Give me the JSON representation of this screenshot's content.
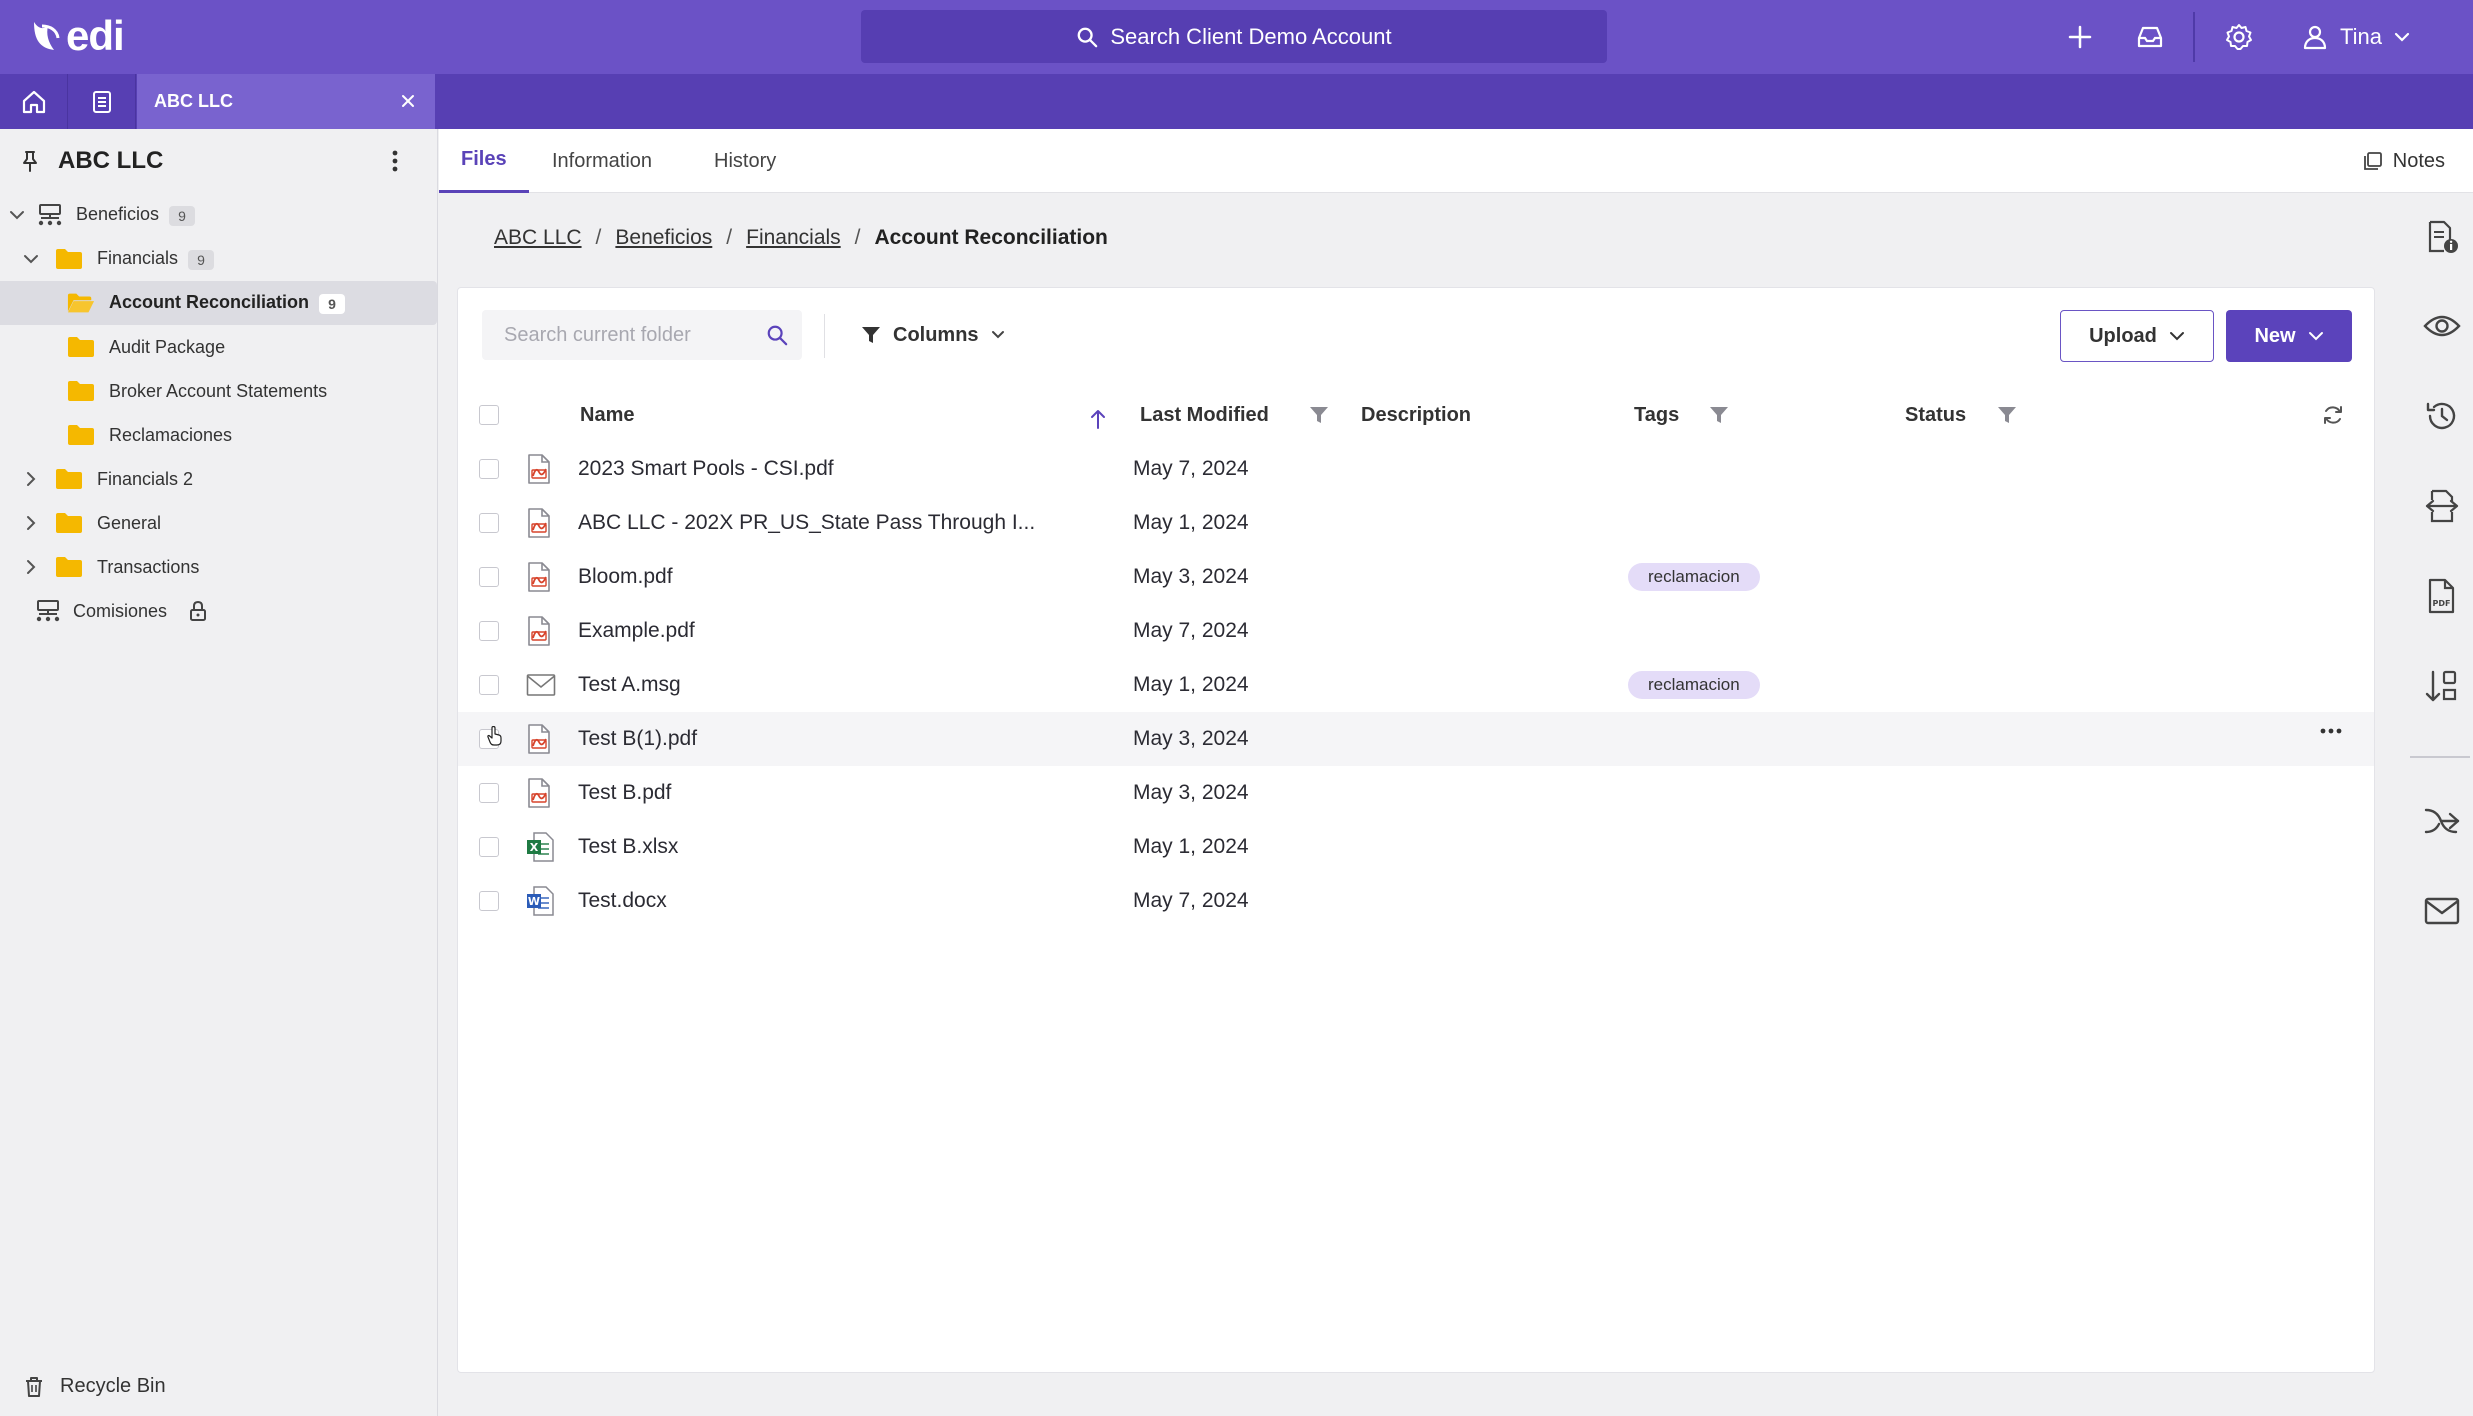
{
  "app": {
    "logo_text": "edi",
    "search_placeholder": "Search Client Demo Account",
    "user_name": "Tina"
  },
  "tabs": {
    "open_tab_label": "ABC LLC"
  },
  "sidebar": {
    "client_name": "ABC LLC",
    "tree": [
      {
        "label": "Beneficios",
        "count": "9"
      },
      {
        "label": "Financials",
        "count": "9"
      },
      {
        "label": "Account Reconciliation",
        "count": "9"
      },
      {
        "label": "Audit Package"
      },
      {
        "label": "Broker Account Statements"
      },
      {
        "label": "Reclamaciones"
      },
      {
        "label": "Financials 2"
      },
      {
        "label": "General"
      },
      {
        "label": "Transactions"
      },
      {
        "label": "Comisiones"
      }
    ],
    "recycle_bin": "Recycle Bin"
  },
  "content_tabs": {
    "files": "Files",
    "information": "Information",
    "history": "History",
    "notes": "Notes"
  },
  "breadcrumb": {
    "items": [
      "ABC LLC",
      "Beneficios",
      "Financials"
    ],
    "current": "Account Reconciliation",
    "separator": "/"
  },
  "toolbar": {
    "search_placeholder": "Search current folder",
    "columns_label": "Columns",
    "upload_label": "Upload",
    "new_label": "New"
  },
  "table": {
    "headers": {
      "name": "Name",
      "last_modified": "Last Modified",
      "description": "Description",
      "tags": "Tags",
      "status": "Status"
    },
    "rows": [
      {
        "type": "pdf",
        "name": "2023 Smart Pools - CSI.pdf",
        "modified": "May 7, 2024",
        "tag": ""
      },
      {
        "type": "pdf",
        "name": "ABC LLC - 202X PR_US_State Pass Through I...",
        "modified": "May 1, 2024",
        "tag": ""
      },
      {
        "type": "pdf",
        "name": "Bloom.pdf",
        "modified": "May 3, 2024",
        "tag": "reclamacion"
      },
      {
        "type": "pdf",
        "name": "Example.pdf",
        "modified": "May 7, 2024",
        "tag": ""
      },
      {
        "type": "msg",
        "name": "Test A.msg",
        "modified": "May 1, 2024",
        "tag": "reclamacion"
      },
      {
        "type": "pdf",
        "name": "Test B(1).pdf",
        "modified": "May 3, 2024",
        "tag": ""
      },
      {
        "type": "pdf",
        "name": "Test B.pdf",
        "modified": "May 3, 2024",
        "tag": ""
      },
      {
        "type": "xlsx",
        "name": "Test B.xlsx",
        "modified": "May 1, 2024",
        "tag": ""
      },
      {
        "type": "docx",
        "name": "Test.docx",
        "modified": "May 7, 2024",
        "tag": ""
      }
    ]
  },
  "colors": {
    "topbar": "#6b52c6",
    "tabbar": "#573fb3",
    "accent": "#5b43bb",
    "folder": "#f5b800",
    "tag_bg": "#e4dcf8"
  },
  "icons": {
    "rail": [
      "file-info-icon",
      "eye-icon",
      "history-icon",
      "file-transfer-icon",
      "pdf-file-icon",
      "sort-tool-icon",
      "merge-arrow-icon",
      "mail-icon"
    ]
  }
}
